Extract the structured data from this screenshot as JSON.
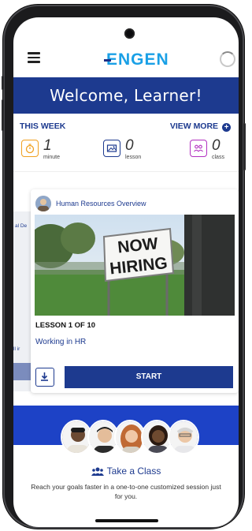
{
  "app": {
    "logo_text": "ENGEN",
    "brand_color": "#1d3a8f",
    "accent_color": "#1aa0e6",
    "welcome_text": "Welcome, Learner!"
  },
  "this_week": {
    "title": "THIS WEEK",
    "view_more_label": "VIEW MORE",
    "view_more_icon": "plus-circle-icon",
    "stats": [
      {
        "value": "1",
        "label": "minute",
        "icon": "stopwatch-icon",
        "color": "#f0a020"
      },
      {
        "value": "0",
        "label": "lesson",
        "icon": "lesson-image-icon",
        "color": "#1d3a8f"
      },
      {
        "value": "0",
        "label": "class",
        "icon": "people-icon",
        "color": "#b230c0"
      }
    ]
  },
  "carousel": {
    "prev_fragment": "al De",
    "prev_fragment_2": "ll ir"
  },
  "course_card": {
    "course_name": "Human Resources Overview",
    "image_sign_line1": "NOW",
    "image_sign_line2": "HIRING",
    "lesson_label": "LESSON 1 OF 10",
    "lesson_title": "Working in HR",
    "download_icon": "download-icon",
    "start_label": "START"
  },
  "take_class": {
    "title": "Take a Class",
    "icon": "people-icon",
    "description": "Reach your goals faster in a one-to-one customized session just for you."
  }
}
